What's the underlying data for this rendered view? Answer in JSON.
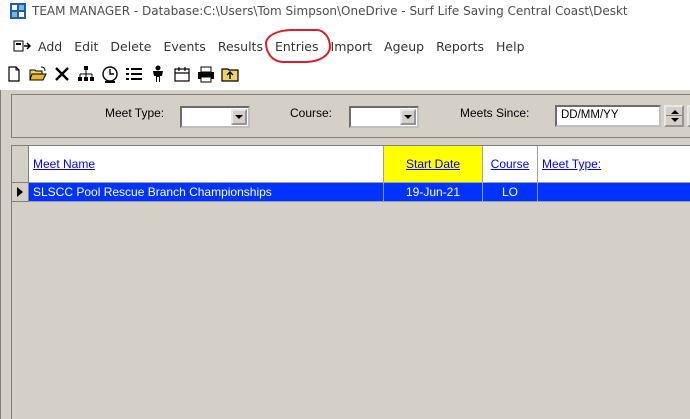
{
  "window": {
    "title": "TEAM MANAGER - Database:C:\\Users\\Tom Simpson\\OneDrive - Surf Life Saving Central Coast\\Deskt"
  },
  "menu": {
    "items": [
      "Add",
      "Edit",
      "Delete",
      "Events",
      "Results",
      "Entries",
      "Import",
      "Ageup",
      "Reports",
      "Help"
    ],
    "highlighted": "Entries",
    "highlight_color": "#e01c24"
  },
  "toolbar": {
    "icons": [
      "new-document-icon",
      "open-folder-icon",
      "delete-x-icon",
      "team-tree-icon",
      "clock-icon",
      "list-icon",
      "swimmer-icon",
      "calendar-icon",
      "printer-icon",
      "import-folder-icon"
    ]
  },
  "filters": {
    "meet_type_label": "Meet Type:",
    "meet_type_value": "",
    "course_label": "Course:",
    "course_value": "",
    "meets_since_label": "Meets Since:",
    "meets_since_value": "DD/MM/YY"
  },
  "grid": {
    "columns": [
      "Meet Name",
      "Start Date",
      "Course",
      "Meet Type:"
    ],
    "sorted_column": "Start Date",
    "rows": [
      {
        "meet_name": "SLSCC Pool Rescue Branch Championships",
        "start_date": "19-Jun-21",
        "course": "LO",
        "meet_type": ""
      }
    ],
    "selection_color": "#0033ff",
    "sort_highlight_color": "#ffff00"
  }
}
